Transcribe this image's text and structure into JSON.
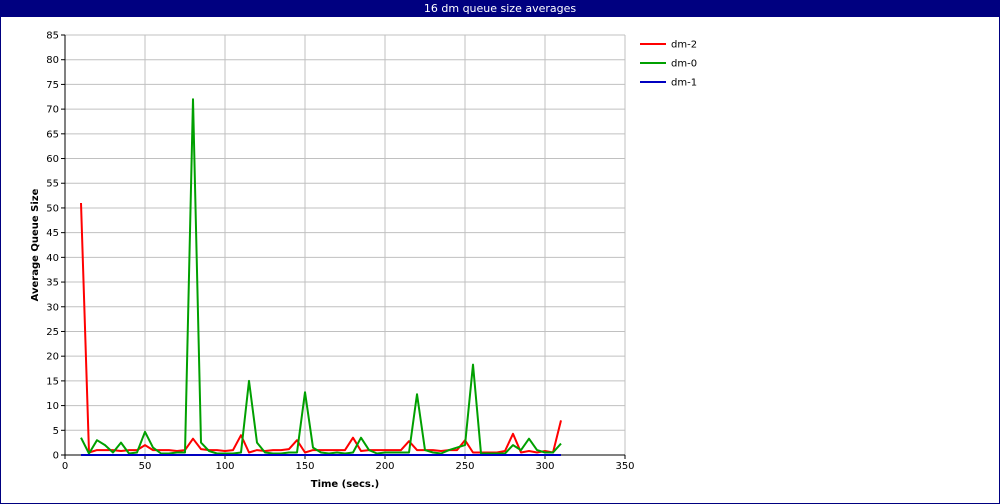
{
  "window": {
    "title": "16 dm queue size averages"
  },
  "chart_data": {
    "type": "line",
    "title": "16 dm queue size averages",
    "xlabel": "Time (secs.)",
    "ylabel": "Average Queue Size",
    "xlim": [
      0,
      350
    ],
    "ylim": [
      0,
      85
    ],
    "xticks": [
      0,
      50,
      100,
      150,
      200,
      250,
      300,
      350
    ],
    "yticks": [
      0,
      5,
      10,
      15,
      20,
      25,
      30,
      35,
      40,
      45,
      50,
      55,
      60,
      65,
      70,
      75,
      80,
      85
    ],
    "grid": true,
    "legend_position": "top-right outside plot",
    "series": [
      {
        "name": "dm-2",
        "color": "#ff0000",
        "x": [
          10,
          15,
          20,
          25,
          30,
          35,
          40,
          45,
          50,
          55,
          60,
          65,
          70,
          75,
          80,
          85,
          90,
          95,
          100,
          105,
          110,
          115,
          120,
          125,
          130,
          135,
          140,
          145,
          150,
          155,
          160,
          165,
          170,
          175,
          180,
          185,
          190,
          195,
          200,
          205,
          210,
          215,
          220,
          225,
          230,
          235,
          240,
          245,
          250,
          255,
          260,
          265,
          270,
          275,
          280,
          285,
          290,
          295,
          300,
          305,
          310
        ],
        "values": [
          51,
          0.5,
          1.0,
          1.0,
          1.0,
          0.8,
          1.0,
          1.0,
          2.0,
          1.0,
          1.0,
          1.0,
          0.8,
          1.0,
          3.3,
          1.2,
          1.0,
          1.0,
          0.8,
          1.0,
          4.0,
          0.5,
          1.0,
          0.8,
          1.0,
          1.0,
          1.2,
          3.0,
          0.5,
          1.0,
          1.0,
          1.0,
          1.0,
          1.0,
          3.5,
          0.8,
          1.0,
          1.0,
          1.0,
          1.0,
          1.0,
          2.8,
          1.0,
          1.0,
          1.0,
          0.8,
          1.0,
          1.0,
          3.0,
          0.5,
          0.5,
          0.5,
          0.5,
          0.8,
          4.3,
          0.5,
          0.8,
          0.5,
          0.8,
          0.5,
          7.0
        ]
      },
      {
        "name": "dm-0",
        "color": "#00a000",
        "x": [
          10,
          15,
          20,
          25,
          30,
          35,
          40,
          45,
          50,
          55,
          60,
          65,
          70,
          75,
          80,
          85,
          90,
          95,
          100,
          105,
          110,
          115,
          120,
          125,
          130,
          135,
          140,
          145,
          150,
          155,
          160,
          165,
          170,
          175,
          180,
          185,
          190,
          195,
          200,
          205,
          210,
          215,
          220,
          225,
          230,
          235,
          240,
          245,
          250,
          255,
          260,
          265,
          270,
          275,
          280,
          285,
          290,
          295,
          300,
          305,
          310
        ],
        "values": [
          3.5,
          0.3,
          3.0,
          2.0,
          0.5,
          2.5,
          0.3,
          0.5,
          4.7,
          1.5,
          0.3,
          0.3,
          0.5,
          0.5,
          72,
          2.5,
          0.8,
          0.3,
          0.3,
          0.3,
          0.5,
          15,
          2.5,
          0.5,
          0.3,
          0.3,
          0.5,
          0.5,
          12.7,
          1.5,
          0.5,
          0.3,
          0.5,
          0.3,
          0.5,
          3.5,
          1.0,
          0.3,
          0.5,
          0.5,
          0.5,
          0.5,
          12.3,
          1.0,
          0.5,
          0.3,
          1.0,
          1.5,
          2.0,
          18.3,
          0.3,
          0.3,
          0.3,
          0.3,
          2.0,
          1.0,
          3.3,
          1.0,
          0.5,
          0.5,
          2.3
        ]
      },
      {
        "name": "dm-1",
        "color": "#0000c0",
        "x": [
          10,
          50,
          100,
          150,
          200,
          250,
          300,
          310
        ],
        "values": [
          0,
          0,
          0,
          0,
          0,
          0,
          0,
          0
        ]
      }
    ]
  }
}
